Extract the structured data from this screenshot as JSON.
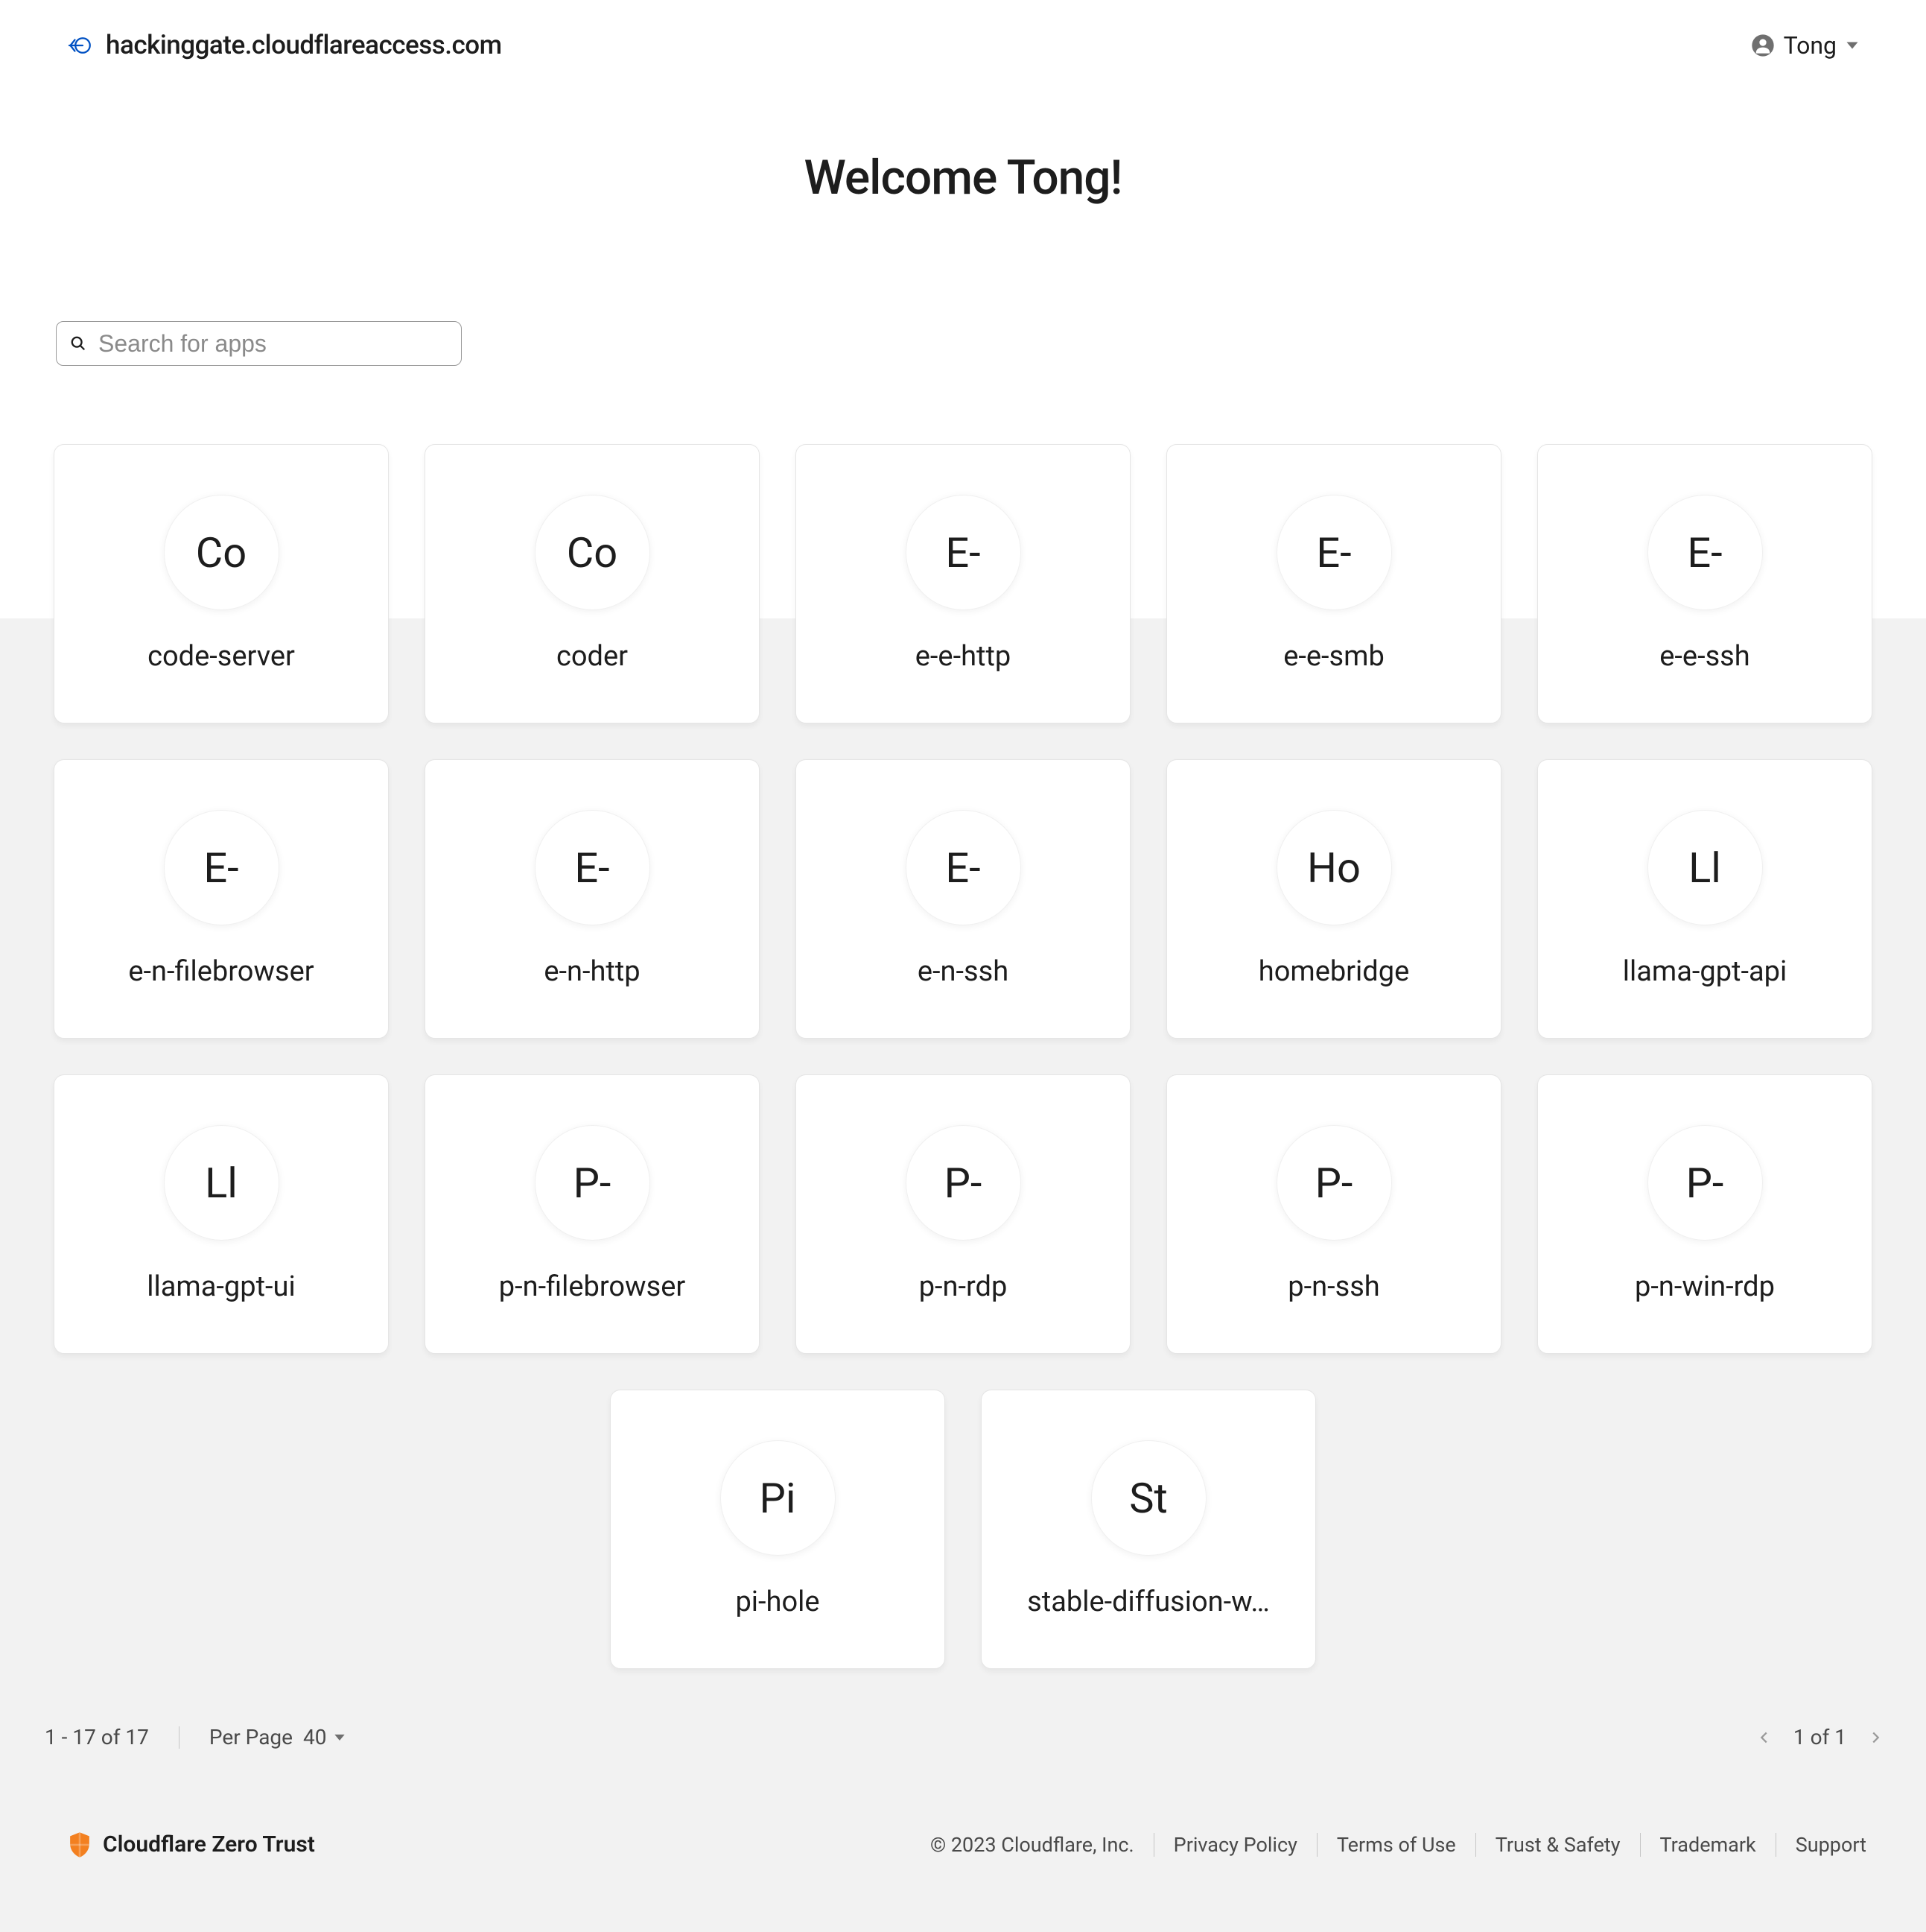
{
  "header": {
    "domain": "hackinggate.cloudflareaccess.com",
    "user_name": "Tong"
  },
  "welcome": "Welcome Tong!",
  "search": {
    "placeholder": "Search for apps"
  },
  "apps": [
    {
      "initials": "Co",
      "name": "code-server"
    },
    {
      "initials": "Co",
      "name": "coder"
    },
    {
      "initials": "E-",
      "name": "e-e-http"
    },
    {
      "initials": "E-",
      "name": "e-e-smb"
    },
    {
      "initials": "E-",
      "name": "e-e-ssh"
    },
    {
      "initials": "E-",
      "name": "e-n-filebrowser"
    },
    {
      "initials": "E-",
      "name": "e-n-http"
    },
    {
      "initials": "E-",
      "name": "e-n-ssh"
    },
    {
      "initials": "Ho",
      "name": "homebridge"
    },
    {
      "initials": "Ll",
      "name": "llama-gpt-api"
    },
    {
      "initials": "Ll",
      "name": "llama-gpt-ui"
    },
    {
      "initials": "P-",
      "name": "p-n-filebrowser"
    },
    {
      "initials": "P-",
      "name": "p-n-rdp"
    },
    {
      "initials": "P-",
      "name": "p-n-ssh"
    },
    {
      "initials": "P-",
      "name": "p-n-win-rdp"
    },
    {
      "initials": "Pi",
      "name": "pi-hole"
    },
    {
      "initials": "St",
      "name": "stable-diffusion-w…"
    }
  ],
  "pager": {
    "range": "1 - 17 of 17",
    "per_page_label": "Per Page",
    "per_page_value": "40",
    "page_info": "1 of 1"
  },
  "footer": {
    "brand": "Cloudflare Zero Trust",
    "copyright": "© 2023 Cloudflare, Inc.",
    "links": [
      "Privacy Policy",
      "Terms of Use",
      "Trust & Safety",
      "Trademark",
      "Support"
    ]
  }
}
